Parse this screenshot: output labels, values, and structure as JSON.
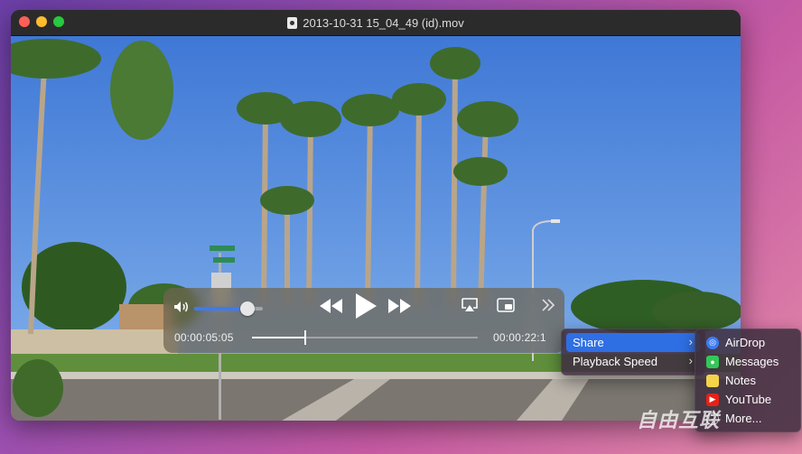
{
  "window": {
    "title": "2013-10-31 15_04_49 (id).mov"
  },
  "controls": {
    "volume_level": 0.78,
    "progress": 0.23,
    "current_time": "00:00:05:05",
    "duration": "00:00:22:1",
    "icons": [
      "speaker-icon",
      "rewind-icon",
      "play-icon",
      "fast-forward-icon",
      "airplay-icon",
      "picture-in-picture-icon",
      "more-icon"
    ]
  },
  "menu": {
    "items": [
      {
        "label": "Share",
        "highlighted": true,
        "submenu": true
      },
      {
        "label": "Playback Speed",
        "highlighted": false,
        "submenu": true
      }
    ],
    "accent": "#2f6fe4"
  },
  "share_menu": {
    "items": [
      {
        "label": "AirDrop",
        "icon": "airdrop-icon",
        "color": "#3d7cf2"
      },
      {
        "label": "Messages",
        "icon": "messages-icon",
        "color": "#34c759"
      },
      {
        "label": "Notes",
        "icon": "notes-icon",
        "color": "#f5d44a"
      },
      {
        "label": "YouTube",
        "icon": "youtube-icon",
        "color": "#e62117"
      },
      {
        "label": "More...",
        "icon": "more-circle-icon",
        "color": "#8e8e93"
      }
    ]
  },
  "watermark": "自由互联"
}
